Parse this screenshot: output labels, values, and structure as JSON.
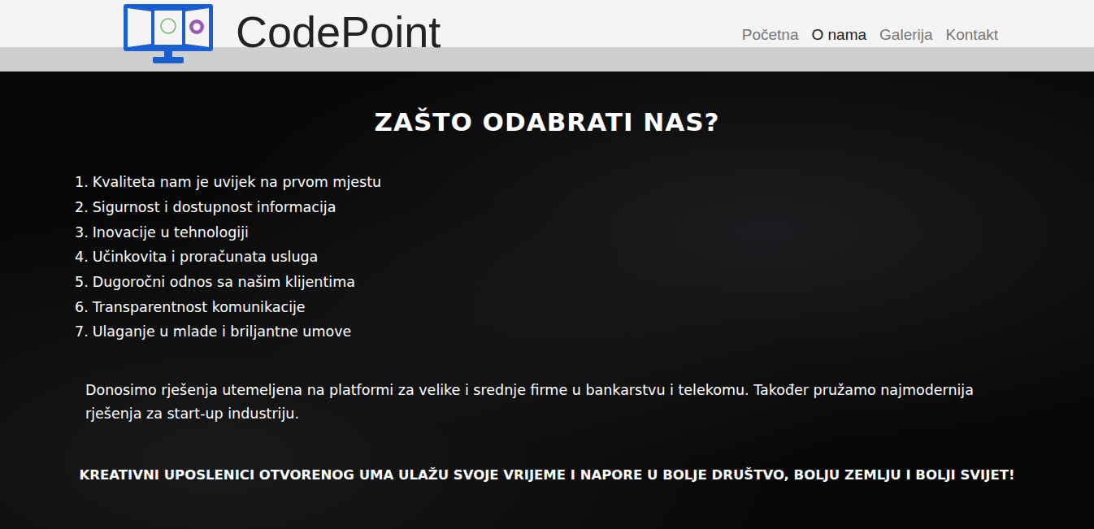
{
  "brand": {
    "name": "CodePoint"
  },
  "nav": [
    {
      "label": "Početna",
      "selected": false
    },
    {
      "label": "O nama",
      "selected": true
    },
    {
      "label": "Galerija",
      "selected": false
    },
    {
      "label": "Kontakt",
      "selected": false
    }
  ],
  "hero": {
    "title": "ZAŠTO ODABRATI NAS?",
    "reasons": [
      {
        "number": "1.",
        "text": "Kvaliteta nam je uvijek na prvom mjestu"
      },
      {
        "number": "2.",
        "text": "Sigurnost i dostupnost informacija"
      },
      {
        "number": "3.",
        "text": "Inovacije u tehnologiji"
      },
      {
        "number": "4.",
        "text": "Učinkovita i proračunata usluga"
      },
      {
        "number": "5.",
        "text": "Dugoročni odnos sa našim klijentima"
      },
      {
        "number": "6.",
        "text": "Transparentnost komunikacije"
      },
      {
        "number": "7.",
        "text": "Ulaganje u mlade i briljantne umove"
      }
    ],
    "paragraph": "Donosimo rješenja utemeljena na platformi za velike i srednje firme u bankarstvu i telekomu. Također pružamo najmodernija rješenja za start-up industriju.",
    "slogan": "KREATIVNI UPOSLENICI OTVORENOG UMA ULAŽU SVOJE VRIJEME I NAPORE U BOLJE DRUŠTVO, BOLJU ZEMLJU I BOLJI SVIJET!"
  }
}
